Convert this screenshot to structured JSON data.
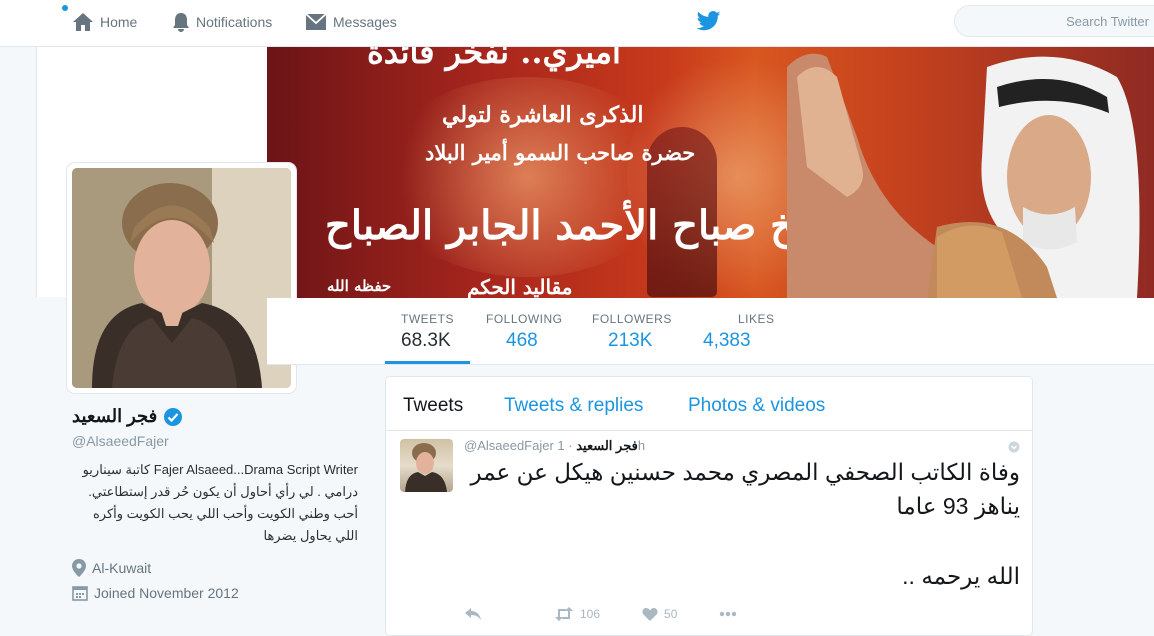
{
  "topbar": {
    "home_label": "Home",
    "notifications_label": "Notifications",
    "messages_label": "Messages",
    "search_placeholder": "Search Twitter",
    "brand_color": "#1b95e0"
  },
  "banner": {
    "top_text": "أميري.. نفخر فائدة",
    "line1": "الذكرى العاشرة لتولي",
    "line2": "حضرة صاحب السمو أمير البلاد",
    "line3": "الشيخ صباح الأحمد الجابر الصباح",
    "line4": "مقاليد الحكم",
    "line5": "حفظه الله"
  },
  "stats": [
    {
      "label": "TWEETS",
      "value": "68.3K"
    },
    {
      "label": "FOLLOWING",
      "value": "468"
    },
    {
      "label": "FOLLOWERS",
      "value": "213K"
    },
    {
      "label": "LIKES",
      "value": "4,383"
    }
  ],
  "profile": {
    "name": "فجر السعيد",
    "handle": "@AlsaeedFajer",
    "bio": "Fajer Alsaeed...Drama Script Writer كاتبة سيناريو درامي . لي رأي أحاول أن يكون حُر قدر إستطاعتي. أحب وطني الكويت وأحب اللي يحب الكويت وأكره اللي يحاول يضرها",
    "location": "Al-Kuwait",
    "joined": "Joined November 2012"
  },
  "timeline": {
    "tabs": [
      "Tweets",
      "Tweets & replies",
      "Photos & videos"
    ],
    "tweet": {
      "author": "فجر السعيد",
      "handle": "@AlsaeedFajer",
      "time": "· 1h",
      "text_line1": "وفاة الكاتب الصحفي المصري محمد حسنين هيكل عن عمر يناهز 93 عاما",
      "text_line2": "الله يرحمه ..",
      "retweets": "106",
      "likes": "50"
    }
  }
}
